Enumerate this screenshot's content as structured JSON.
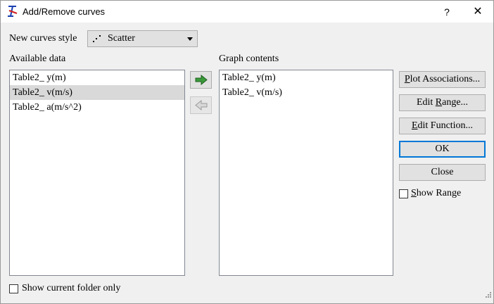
{
  "window": {
    "title": "Add/Remove curves",
    "help_label": "?",
    "close_label": "✕"
  },
  "style_row": {
    "label": "New curves style",
    "selected_value": "Scatter",
    "icon": "scatter-style-icon"
  },
  "available": {
    "label": "Available data",
    "items": [
      {
        "text": "Table2_ y(m)",
        "selected": false
      },
      {
        "text": "Table2_ v(m/s)",
        "selected": true
      },
      {
        "text": "Table2_ a(m/s^2)",
        "selected": false
      }
    ]
  },
  "graph": {
    "label": "Graph contents",
    "items": [
      {
        "text": "Table2_ y(m)"
      },
      {
        "text": "Table2_ v(m/s)"
      }
    ]
  },
  "move_buttons": {
    "add_icon": "arrow-right-icon",
    "remove_icon": "arrow-left-icon",
    "add_color": "#3a9a3a",
    "remove_color": "#9a9a9a"
  },
  "buttons": {
    "plot_associations": {
      "pre": "",
      "key": "P",
      "post": "lot Associations..."
    },
    "edit_range": {
      "pre": "Edit ",
      "key": "R",
      "post": "ange..."
    },
    "edit_function": {
      "pre": "",
      "key": "E",
      "post": "dit Function..."
    },
    "ok": "OK",
    "close": "Close"
  },
  "show_range": {
    "key": "S",
    "post": "how Range",
    "checked": false
  },
  "show_current_folder": {
    "label": "Show current folder only",
    "checked": false
  },
  "colors": {
    "accent": "#0078d7",
    "selection": "#d9d9d9"
  }
}
